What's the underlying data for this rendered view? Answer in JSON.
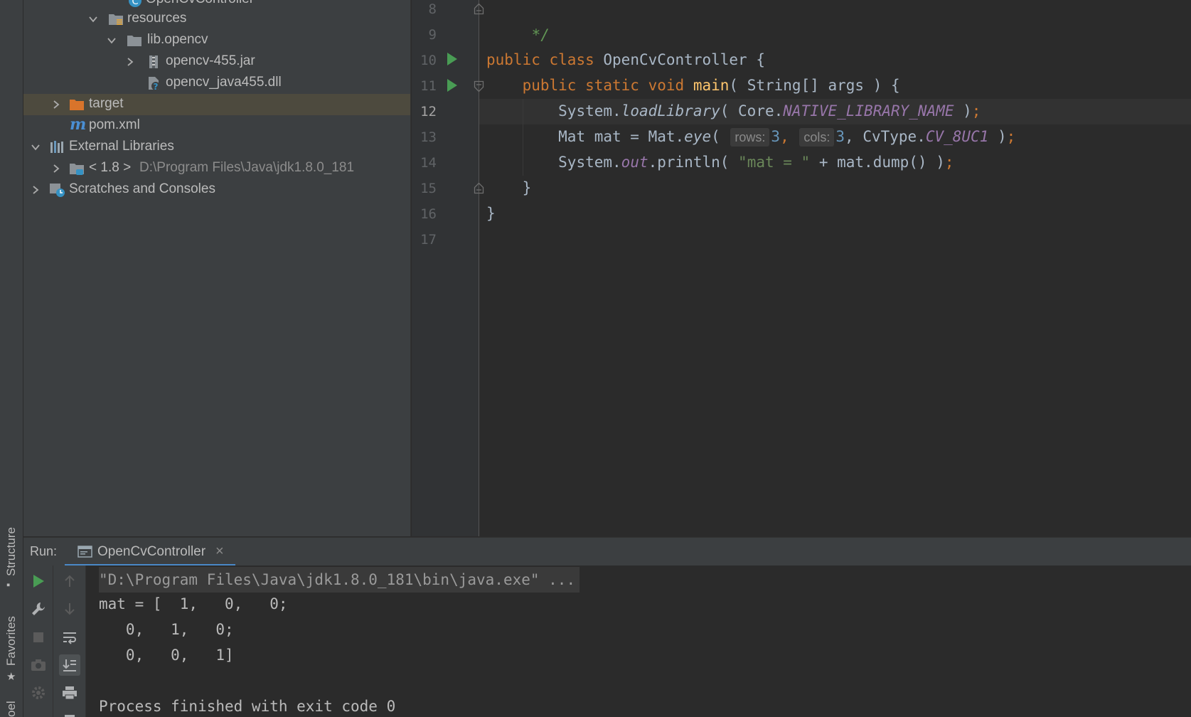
{
  "left_strip": {
    "structure_label": "Structure",
    "favorites_label": "Favorites",
    "bottom_label": "oel"
  },
  "project_tree": {
    "items": [
      {
        "label": "OpenCvController",
        "icon": "java-class-icon"
      },
      {
        "label": "resources",
        "icon": "resources-folder-icon"
      },
      {
        "label": "lib.opencv",
        "icon": "folder-icon"
      },
      {
        "label": "opencv-455.jar",
        "icon": "jar-icon"
      },
      {
        "label": "opencv_java455.dll",
        "icon": "unknown-file-icon"
      },
      {
        "label": "target",
        "icon": "excluded-folder-icon"
      },
      {
        "label": "pom.xml",
        "icon": "maven-icon"
      },
      {
        "label": "External Libraries",
        "icon": "libraries-icon"
      },
      {
        "label": "< 1.8 >",
        "path": "D:\\Program Files\\Java\\jdk1.8.0_181",
        "icon": "jdk-icon"
      },
      {
        "label": "Scratches and Consoles",
        "icon": "scratches-icon"
      }
    ]
  },
  "editor": {
    "line_numbers": [
      "8",
      "9",
      "10",
      "11",
      "12",
      "13",
      "14",
      "15",
      "16",
      "17"
    ],
    "current_line": "12",
    "code": {
      "l8": "*/",
      "l10_kw1": "public",
      "l10_kw2": "class",
      "l10_name": "OpenCvController",
      "l10_brace": "{",
      "l11_kw1": "public",
      "l11_kw2": "static",
      "l11_kw3": "void",
      "l11_fn": "main",
      "l11_rest": "( String[] args ) {",
      "l12_a": "System.",
      "l12_fn": "loadLibrary",
      "l12_b": "( Core.",
      "l12_const": "NATIVE_LIBRARY_NAME",
      "l12_c": " )",
      "l12_semi": ";",
      "l13_a": "Mat mat = Mat.",
      "l13_fn": "eye",
      "l13_b": "( ",
      "l13_hint1": "rows:",
      "l13_n1": "3",
      "l13_comma1": ", ",
      "l13_hint2": "cols:",
      "l13_n2": "3",
      "l13_c": ", CvType.",
      "l13_const": "CV_8UC1",
      "l13_d": " )",
      "l13_semi": ";",
      "l14_a": "System.",
      "l14_field": "out",
      "l14_b": ".println( ",
      "l14_str": "\"mat = \"",
      "l14_c": " + mat.dump() )",
      "l14_semi": ";",
      "l15": "}",
      "l16": "}"
    }
  },
  "run_panel": {
    "label": "Run:",
    "tab_label": "OpenCvController",
    "close_symbol": "×",
    "console": [
      "\"D:\\Program Files\\Java\\jdk1.8.0_181\\bin\\java.exe\" ...",
      "mat = [  1,   0,   0;",
      "   0,   1,   0;",
      "   0,   0,   1]",
      "",
      "Process finished with exit code 0"
    ]
  },
  "colors": {
    "run_green": "#499c54",
    "keyword": "#cc7832",
    "function": "#ffc66d",
    "constant": "#9876aa",
    "number": "#6897bb",
    "string": "#6a8759",
    "tab_underline": "#4a88c7"
  }
}
